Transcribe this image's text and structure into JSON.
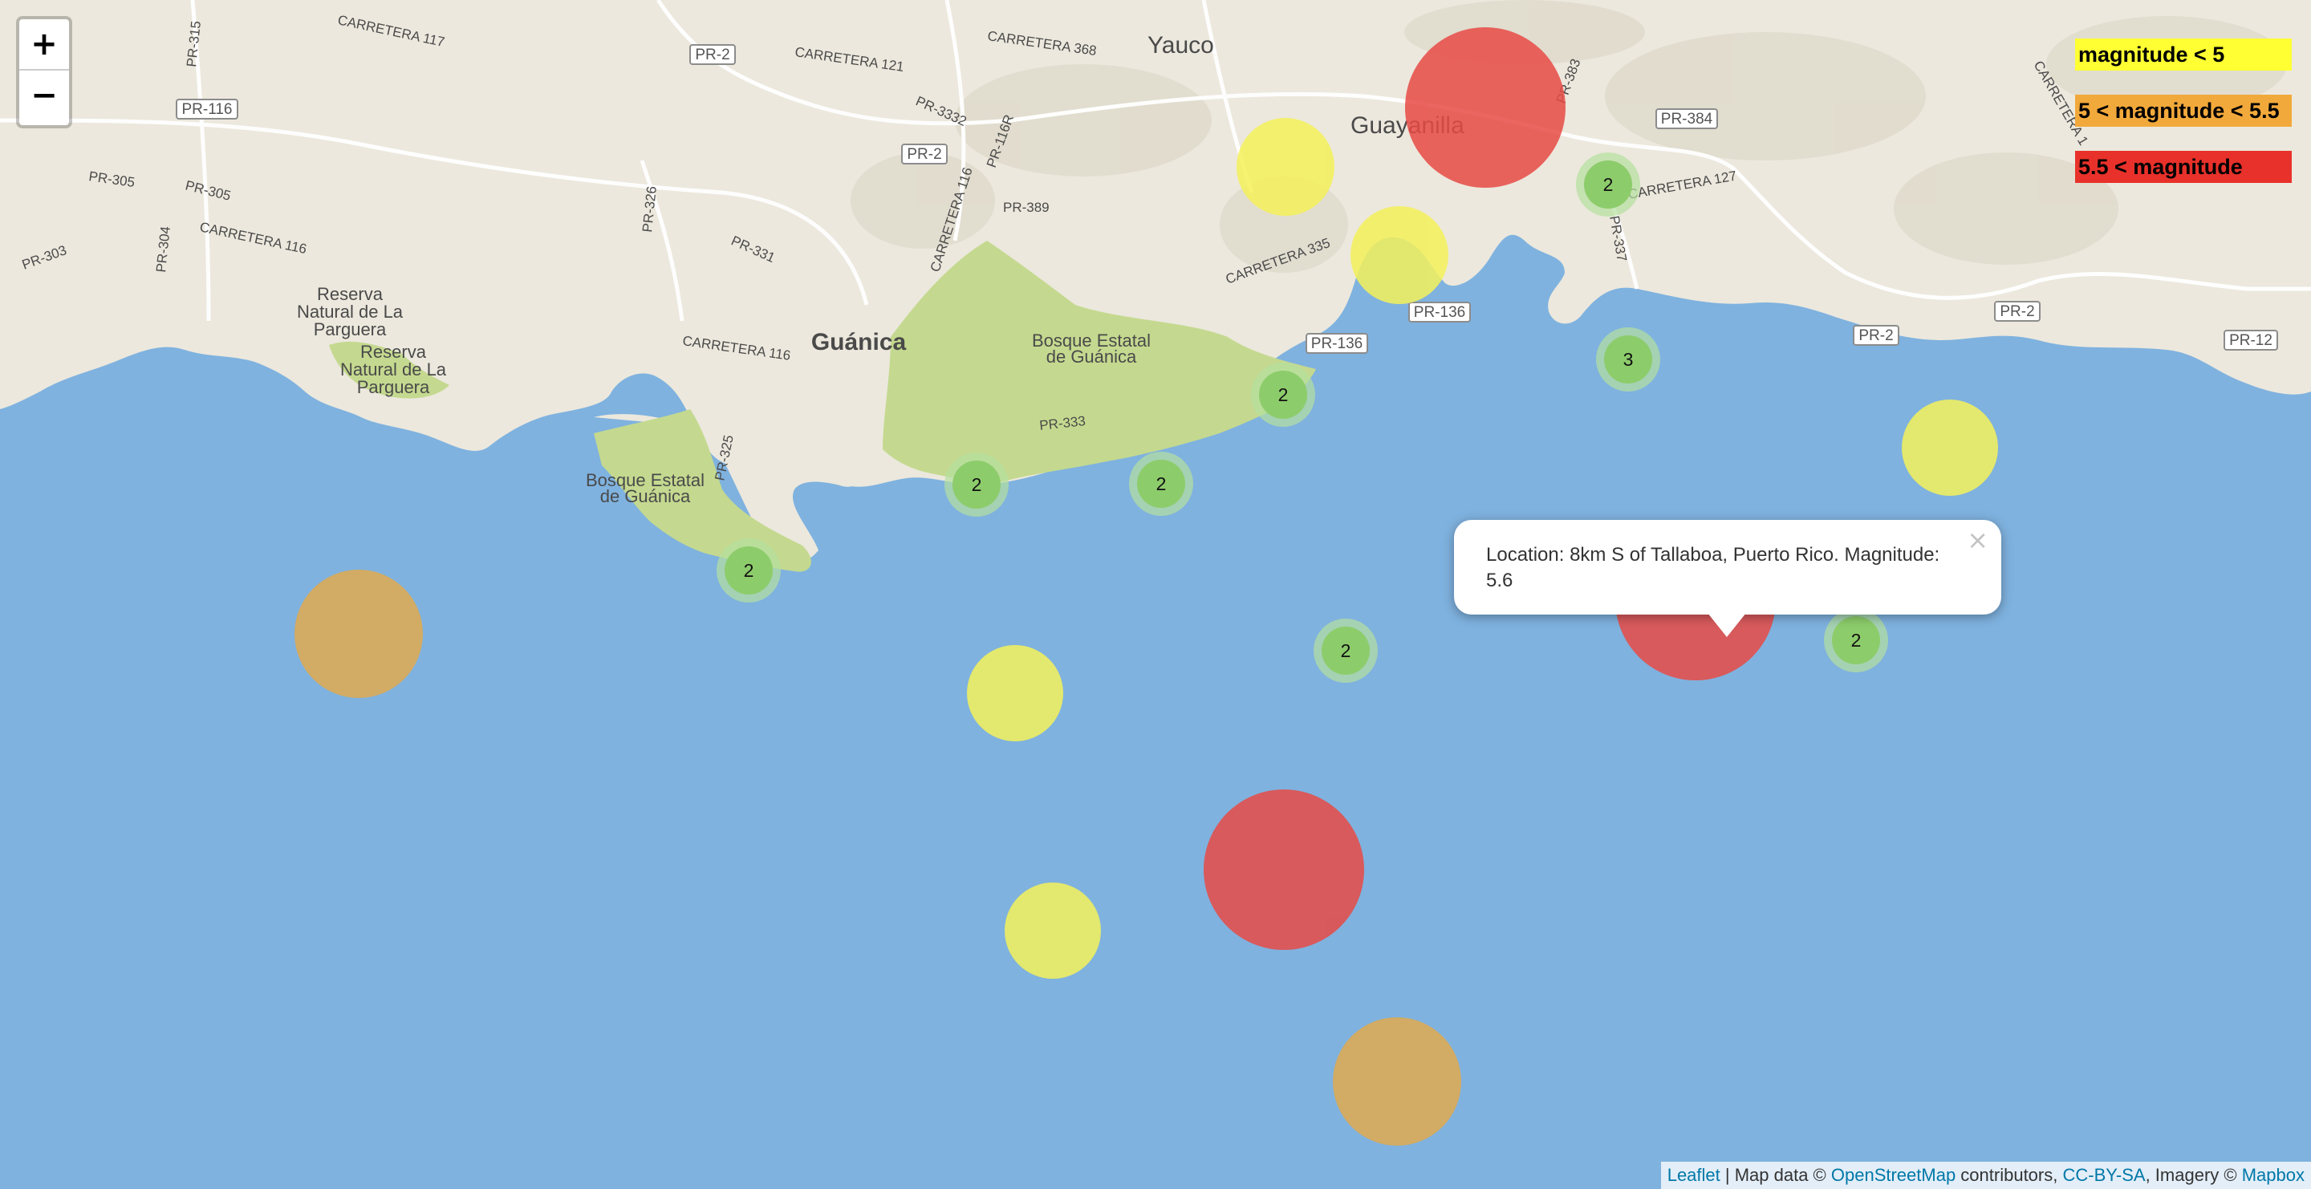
{
  "place_labels": [
    {
      "id": "yauco",
      "text": "Yauco"
    },
    {
      "id": "guayanilla",
      "text": "Guayanilla"
    },
    {
      "id": "guanica",
      "text": "Guánica"
    },
    {
      "id": "bosque-guanica-east",
      "text": "Bosque Estatal\nde Guánica"
    },
    {
      "id": "bosque-guanica-west",
      "text": "Bosque Estatal\nde Guánica"
    },
    {
      "id": "reserva-parguera-1",
      "text": "Reserva\nNatural de La\nParguera"
    },
    {
      "id": "reserva-parguera-2",
      "text": "Reserva\nNatural de La\nParguera"
    }
  ],
  "road_labels": [
    {
      "id": "carretera-117",
      "text": "CARRETERA 117"
    },
    {
      "id": "carretera-121",
      "text": "CARRETERA 121"
    },
    {
      "id": "carretera-368",
      "text": "CARRETERA 368"
    },
    {
      "id": "pr-3332",
      "text": "PR-3332"
    },
    {
      "id": "pr-116r",
      "text": "PR-116R"
    },
    {
      "id": "pr-389",
      "text": "PR-389"
    },
    {
      "id": "carretera-116-a",
      "text": "CARRETERA 116"
    },
    {
      "id": "carretera-116-b",
      "text": "CARRETERA 116"
    },
    {
      "id": "carretera-116-c",
      "text": "CARRETERA 116"
    },
    {
      "id": "pr-305-a",
      "text": "PR-305"
    },
    {
      "id": "pr-305-b",
      "text": "PR-305"
    },
    {
      "id": "pr-303",
      "text": "PR-303"
    },
    {
      "id": "pr-304",
      "text": "PR-304"
    },
    {
      "id": "pr-315",
      "text": "PR-315"
    },
    {
      "id": "pr-326",
      "text": "PR-326"
    },
    {
      "id": "pr-331",
      "text": "PR-331"
    },
    {
      "id": "pr-325",
      "text": "PR-325"
    },
    {
      "id": "pr-333",
      "text": "PR-333"
    },
    {
      "id": "carretera-335",
      "text": "CARRETERA 335"
    },
    {
      "id": "carretera-127",
      "text": "CARRETERA 127"
    },
    {
      "id": "pr-337",
      "text": "PR-337"
    },
    {
      "id": "pr-383",
      "text": "PR-383"
    },
    {
      "id": "carretera-1",
      "text": "CARRETERA 1"
    }
  ],
  "road_shields": [
    {
      "id": "pr-2-a",
      "text": "PR-2"
    },
    {
      "id": "pr-2-b",
      "text": "PR-2"
    },
    {
      "id": "pr-116",
      "text": "PR-116"
    },
    {
      "id": "pr-136-a",
      "text": "PR-136"
    },
    {
      "id": "pr-136-b",
      "text": "PR-136"
    },
    {
      "id": "pr-384",
      "text": "PR-384"
    },
    {
      "id": "pr-2-c",
      "text": "PR-2"
    },
    {
      "id": "pr-2-d",
      "text": "PR-2"
    },
    {
      "id": "pr-12",
      "text": "PR-12"
    }
  ],
  "zoom": {
    "in_label": "+",
    "out_label": "−"
  },
  "legend": {
    "items": [
      {
        "label": "magnitude < 5",
        "color": "#ffff33"
      },
      {
        "label": "5 < magnitude < 5.5",
        "color": "#f2a93b"
      },
      {
        "label": "5.5 < magnitude",
        "color": "#e8312a"
      }
    ]
  },
  "colors": {
    "water": "#7fb2df",
    "land": "#ece8dd",
    "park": "#c4d98f",
    "low": "#f0f066",
    "mid": "#d9b262",
    "high": "#e0504a",
    "cluster_fill": "#8dcc6b",
    "cluster_halo": "#b5e09e"
  },
  "earthquakes": [
    {
      "id": "q1",
      "category": "high",
      "magnitude_band": "5.5 < magnitude"
    },
    {
      "id": "q2",
      "category": "low",
      "magnitude_band": "magnitude < 5"
    },
    {
      "id": "q3",
      "category": "low",
      "magnitude_band": "magnitude < 5"
    },
    {
      "id": "q4",
      "category": "low",
      "magnitude_band": "magnitude < 5"
    },
    {
      "id": "q5",
      "category": "mid",
      "magnitude_band": "5 < magnitude < 5.5"
    },
    {
      "id": "q6",
      "category": "high",
      "magnitude_band": "5.5 < magnitude"
    },
    {
      "id": "q7",
      "category": "low",
      "magnitude_band": "magnitude < 5"
    },
    {
      "id": "q8",
      "category": "high",
      "magnitude_band": "5.5 < magnitude"
    },
    {
      "id": "q9",
      "category": "low",
      "magnitude_band": "magnitude < 5"
    },
    {
      "id": "q10",
      "category": "mid",
      "magnitude_band": "5 < magnitude < 5.5"
    }
  ],
  "clusters": [
    {
      "id": "c1",
      "count": "2"
    },
    {
      "id": "c2",
      "count": "3"
    },
    {
      "id": "c3",
      "count": "2"
    },
    {
      "id": "c4",
      "count": "2"
    },
    {
      "id": "c5",
      "count": "2"
    },
    {
      "id": "c6",
      "count": "2"
    },
    {
      "id": "c7",
      "count": "2"
    },
    {
      "id": "c8",
      "count": "2"
    }
  ],
  "popup": {
    "text": "Location: 8km S of Tallaboa, Puerto Rico. Magnitude: 5.6",
    "close_label": "×"
  },
  "attribution": {
    "leaflet": "Leaflet",
    "sep1": " | Map data © ",
    "osm": "OpenStreetMap",
    "sep2": " contributors, ",
    "license": "CC-BY-SA",
    "sep3": ", Imagery © ",
    "mapbox": "Mapbox"
  }
}
